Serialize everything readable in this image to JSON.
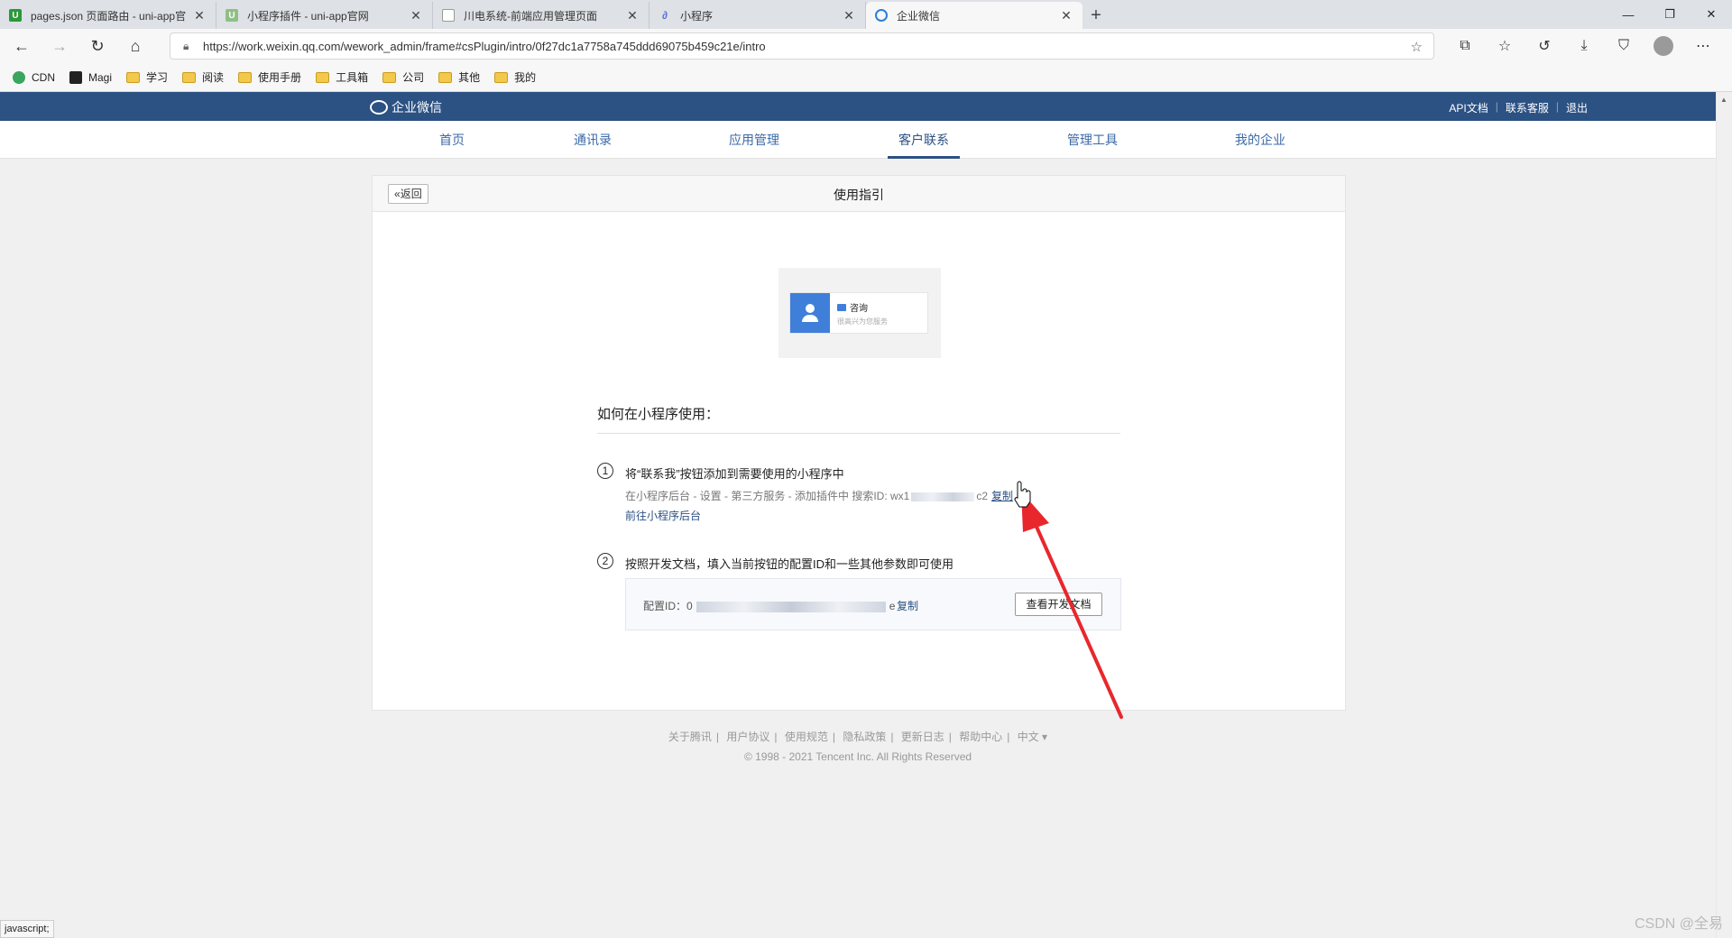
{
  "browser": {
    "tabs": [
      {
        "title": "pages.json 页面路由 - uni-app官",
        "icon": "uniapp-icon",
        "color": "#2b9939",
        "active": false
      },
      {
        "title": "小程序插件 - uni-app官网",
        "icon": "uniapp-icon",
        "color": "#8fbf86",
        "active": false
      },
      {
        "title": "川电系统-前端应用管理页面",
        "icon": "page-icon",
        "color": "#bbbbbb",
        "active": false
      },
      {
        "title": "小程序",
        "icon": "link-icon",
        "color": "#5b6fd6",
        "active": false
      },
      {
        "title": "企业微信",
        "icon": "wework-icon",
        "color": "#2b7fd9",
        "active": true
      }
    ],
    "url": "https://work.weixin.qq.com/wework_admin/frame#csPlugin/intro/0f27dc1a7758a745ddd69075b459c21e/intro",
    "bookmarks": [
      {
        "label": "CDN",
        "icon": "cdn-icon"
      },
      {
        "label": "Magi",
        "icon": "magi-icon"
      },
      {
        "label": "学习",
        "icon": "folder-icon"
      },
      {
        "label": "阅读",
        "icon": "folder-icon"
      },
      {
        "label": "使用手册",
        "icon": "folder-icon"
      },
      {
        "label": "工具箱",
        "icon": "folder-icon"
      },
      {
        "label": "公司",
        "icon": "folder-icon"
      },
      {
        "label": "其他",
        "icon": "folder-icon"
      },
      {
        "label": "我的",
        "icon": "folder-icon"
      }
    ],
    "status_tip": "javascript;"
  },
  "header": {
    "logo_text": "企业微信",
    "links": [
      "API文档",
      "联系客服",
      "退出"
    ],
    "brand_color": "#2c5183"
  },
  "nav": {
    "items": [
      "首页",
      "通讯录",
      "应用管理",
      "客户联系",
      "管理工具",
      "我的企业"
    ],
    "active_index": 3
  },
  "card": {
    "back_label": "返回",
    "title": "使用指引",
    "preview": {
      "title": "咨询",
      "subtitle": "很高兴为您服务"
    },
    "section_title": "如何在小程序使用：",
    "step1": {
      "num": "1",
      "title": "将“联系我”按钮添加到需要使用的小程序中",
      "desc_prefix": "在小程序后台 - 设置 - 第三方服务 - 添加插件中 搜索ID: wx1",
      "desc_suffix": "c2",
      "copy_label": "复制",
      "link_label": "前往小程序后台"
    },
    "step2": {
      "num": "2",
      "title": "按照开发文档，填入当前按钮的配置ID和一些其他参数即可使用",
      "config_label": "配置ID：",
      "config_prefix": "0",
      "config_suffix": "e",
      "copy_label": "复制",
      "doc_button": "查看开发文档"
    }
  },
  "footer": {
    "links": [
      "关于腾讯",
      "用户协议",
      "使用规范",
      "隐私政策",
      "更新日志",
      "帮助中心",
      "中文 ▾"
    ],
    "copyright": "© 1998 - 2021 Tencent Inc. All Rights Reserved"
  },
  "watermark": "CSDN @全易",
  "annotation": {
    "arrow_color": "#e8272d"
  }
}
